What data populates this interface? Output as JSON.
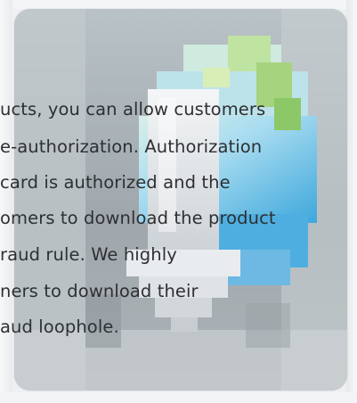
{
  "lines": [
    "ucts, you can allow customers",
    "e-authorization. Authorization",
    "card is authorized and the",
    "omers to download the product",
    "raud rule. We highly",
    "ners to download their",
    "aud loophole."
  ],
  "colors": {
    "background": "#eef0f1",
    "text": "#2e3033",
    "card": "#d7dcdf"
  },
  "artwork": {
    "icon": "pixelated-download-arrow-icon"
  }
}
